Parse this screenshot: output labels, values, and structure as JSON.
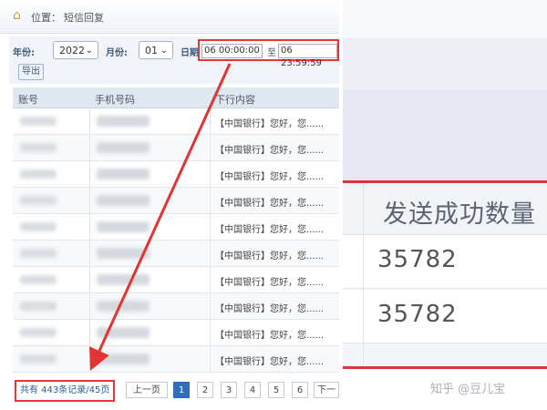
{
  "header": {
    "location_label": "位置：",
    "location_value": "短信回复"
  },
  "filter": {
    "year_label": "年份:",
    "year_value": "2022",
    "month_label": "月份:",
    "month_value": "01",
    "date_label": "日期:",
    "date_start": "06 00:00:00",
    "date_sep": "至",
    "date_end": "06 23:59:59",
    "export_label": "导出"
  },
  "table": {
    "columns": [
      "账号",
      "手机号码",
      "下行内容"
    ],
    "rows": [
      {
        "content": "【中国银行】您好，您......"
      },
      {
        "content": "【中国银行】您好，您......"
      },
      {
        "content": "【中国银行】您好，您......"
      },
      {
        "content": "【中国银行】您好，您......"
      },
      {
        "content": "【中国银行】您好，您......"
      },
      {
        "content": "【中国银行】您好，您......"
      },
      {
        "content": "【中国银行】您好，您......"
      },
      {
        "content": "【中国银行】您好，您......"
      },
      {
        "content": "【中国银行】您好，您......"
      },
      {
        "content": "【中国银行】您好，您......"
      }
    ]
  },
  "pager": {
    "total_text": "共有 443条记录/45页",
    "prev_label": "上一页",
    "pages": [
      "1",
      "2",
      "3",
      "4",
      "5",
      "6"
    ],
    "current_page": "1",
    "next_label": "下一"
  },
  "right_panel": {
    "header": "发送成功数量",
    "values": [
      "35782",
      "35782"
    ]
  },
  "watermark": "知乎 @豆儿宝",
  "colors": {
    "highlight_red": "#e33333",
    "accent_blue": "#2d6fb8"
  }
}
